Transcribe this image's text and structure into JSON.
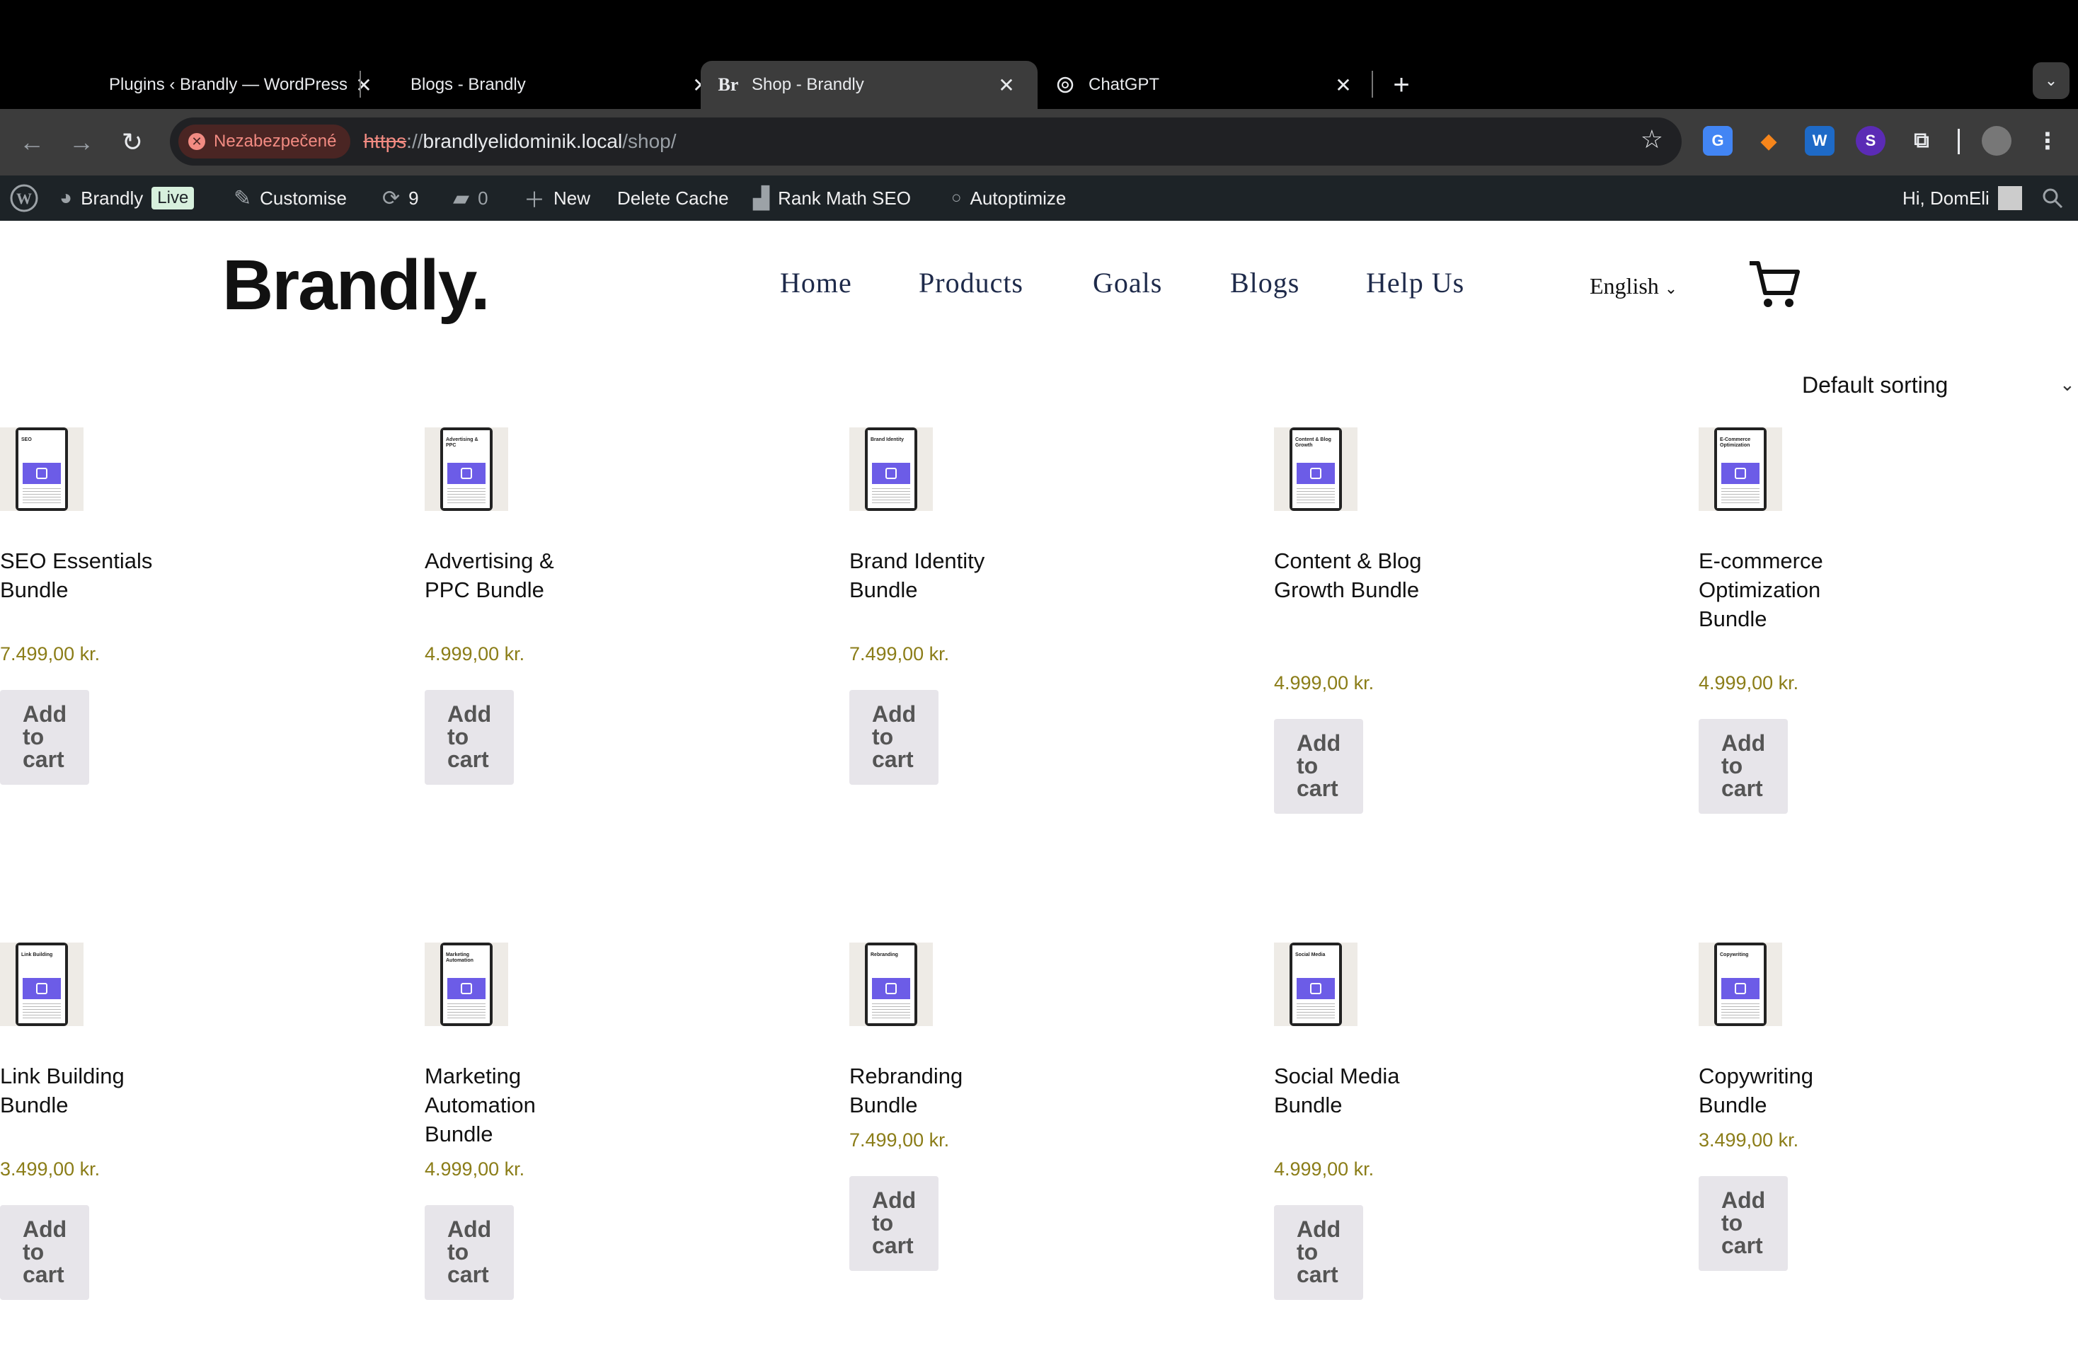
{
  "browser": {
    "tabs": [
      {
        "title": "Plugins ‹ Brandly — WordPress",
        "favicon": "wordpress-icon",
        "active": false
      },
      {
        "title": "Blogs - Brandly",
        "favicon": "",
        "active": false
      },
      {
        "title": "Shop - Brandly",
        "favicon": "Br",
        "active": true
      },
      {
        "title": "ChatGPT",
        "favicon": "chatgpt-icon",
        "active": false
      }
    ],
    "security_label": "Nezabezpečené",
    "url_scheme": "https",
    "url_sep": "://",
    "url_host": "brandlyelidominik.local",
    "url_path": "/shop/"
  },
  "adminbar": {
    "site_name": "Brandly",
    "live_badge": "Live",
    "customise": "Customise",
    "updates_count": "9",
    "comments_count": "0",
    "new": "New",
    "delete_cache": "Delete Cache",
    "rank_math": "Rank Math SEO",
    "autoptimize": "Autoptimize",
    "greeting": "Hi, DomEli"
  },
  "site": {
    "logo": "Brandly.",
    "menu": [
      "Home",
      "Products",
      "Goals",
      "Blogs",
      "Help Us"
    ],
    "language": "English",
    "sorting": "Default sorting"
  },
  "products": [
    {
      "name": "SEO Essentials Bundle",
      "price": "7.499,00 kr.",
      "button": "Add to cart",
      "thumb_title": "SEO"
    },
    {
      "name": "Advertising & PPC Bundle",
      "price": "4.999,00 kr.",
      "button": "Add to cart",
      "thumb_title": "Advertising & PPC"
    },
    {
      "name": "Brand Identity Bundle",
      "price": "7.499,00 kr.",
      "button": "Add to cart",
      "thumb_title": "Brand Identity"
    },
    {
      "name": "Content & Blog Growth Bundle",
      "price": "4.999,00 kr.",
      "button": "Add to cart",
      "thumb_title": "Content & Blog Growth"
    },
    {
      "name": "E-commerce Optimization Bundle",
      "price": "4.999,00 kr.",
      "button": "Add to cart",
      "thumb_title": "E-Commerce Optimization"
    },
    {
      "name": "Link Building Bundle",
      "price": "3.499,00 kr.",
      "button": "Add to cart",
      "thumb_title": "Link Building"
    },
    {
      "name": "Marketing Automation Bundle",
      "price": "4.999,00 kr.",
      "button": "Add to cart",
      "thumb_title": "Marketing Automation"
    },
    {
      "name": "Rebranding Bundle",
      "price": "7.499,00 kr.",
      "button": "Add to cart",
      "thumb_title": "Rebranding"
    },
    {
      "name": "Social Media Bundle",
      "price": "4.999,00 kr.",
      "button": "Add to cart",
      "thumb_title": "Social Media"
    },
    {
      "name": "Copywriting Bundle",
      "price": "3.499,00 kr.",
      "button": "Add to cart",
      "thumb_title": "Copywriting"
    }
  ]
}
